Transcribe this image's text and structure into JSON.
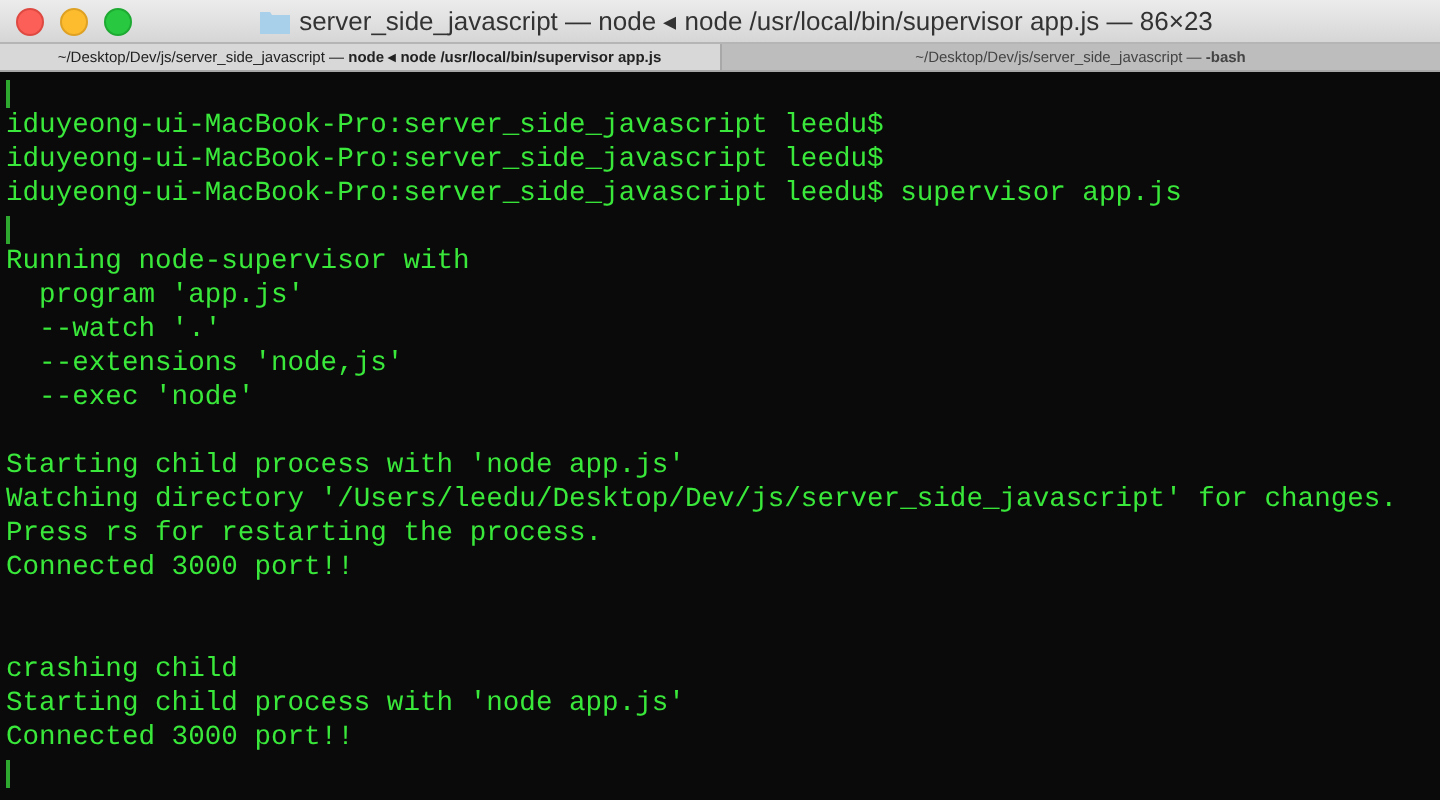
{
  "window": {
    "title": "server_side_javascript — node ◂ node /usr/local/bin/supervisor app.js — 86×23"
  },
  "tabs": [
    {
      "label": "~/Desktop/Dev/js/server_side_javascript — **node ◂ node /usr/local/bin/supervisor app.js**",
      "selected": true
    },
    {
      "label": "~/Desktop/Dev/js/server_side_javascript — **-bash**",
      "selected": false
    }
  ],
  "terminal": {
    "lines": [
      {
        "kind": "cursor"
      },
      {
        "kind": "text",
        "text": "iduyeong-ui-MacBook-Pro:server_side_javascript leedu$"
      },
      {
        "kind": "text",
        "text": "iduyeong-ui-MacBook-Pro:server_side_javascript leedu$"
      },
      {
        "kind": "text",
        "text": "iduyeong-ui-MacBook-Pro:server_side_javascript leedu$ supervisor app.js"
      },
      {
        "kind": "cursor"
      },
      {
        "kind": "text",
        "text": "Running node-supervisor with"
      },
      {
        "kind": "text",
        "text": "  program 'app.js'"
      },
      {
        "kind": "text",
        "text": "  --watch '.'"
      },
      {
        "kind": "text",
        "text": "  --extensions 'node,js'"
      },
      {
        "kind": "text",
        "text": "  --exec 'node'"
      },
      {
        "kind": "blank"
      },
      {
        "kind": "text",
        "text": "Starting child process with 'node app.js'"
      },
      {
        "kind": "text",
        "text": "Watching directory '/Users/leedu/Desktop/Dev/js/server_side_javascript' for changes."
      },
      {
        "kind": "text",
        "text": "Press rs for restarting the process."
      },
      {
        "kind": "text",
        "text": "Connected 3000 port!!"
      },
      {
        "kind": "blank"
      },
      {
        "kind": "blank"
      },
      {
        "kind": "text",
        "text": "crashing child"
      },
      {
        "kind": "text",
        "text": "Starting child process with 'node app.js'"
      },
      {
        "kind": "text",
        "text": "Connected 3000 port!!"
      },
      {
        "kind": "cursor"
      }
    ]
  }
}
